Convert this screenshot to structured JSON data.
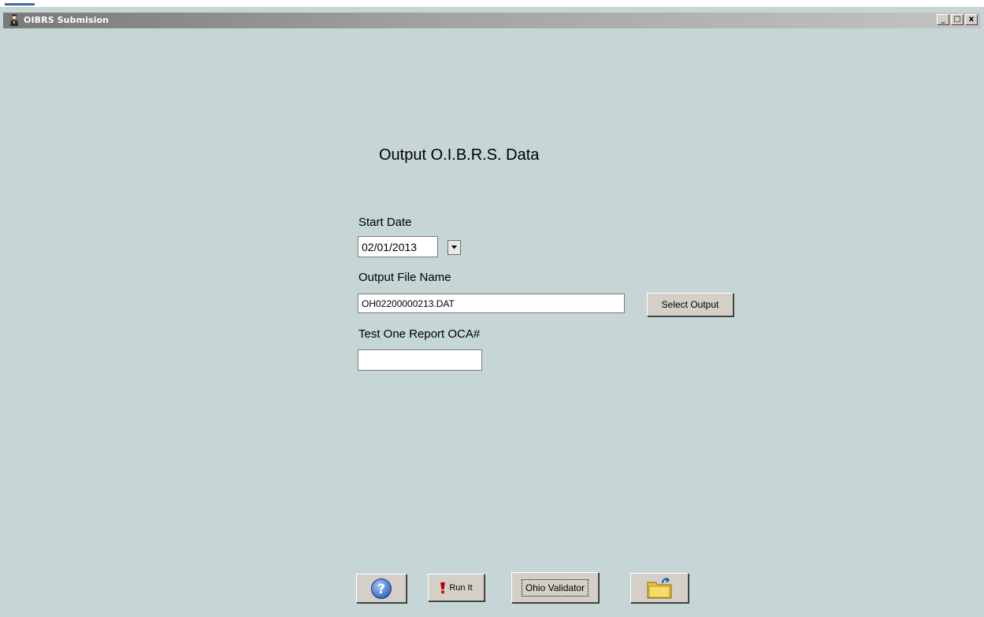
{
  "window": {
    "title": "OIBRS Submision",
    "controls": {
      "minimize": "_",
      "maximize": "□",
      "close": "x"
    }
  },
  "form": {
    "heading": "Output O.I.B.R.S. Data",
    "start_date": {
      "label": "Start Date",
      "value": "02/01/2013"
    },
    "output_file": {
      "label": "Output File Name",
      "value": "OH02200000213.DAT",
      "button_label": "Select Output"
    },
    "test_report": {
      "label": "Test One Report OCA#",
      "value": ""
    }
  },
  "toolbar": {
    "help_icon": "help-icon",
    "run_label": "Run It",
    "validator_label": "Ohio Validator",
    "folder_icon": "open-folder-icon"
  },
  "colors": {
    "background": "#c6d6d6",
    "help_blue": "#3c74c8",
    "alert_red": "#c00000",
    "folder_yellow": "#f6d24a"
  }
}
